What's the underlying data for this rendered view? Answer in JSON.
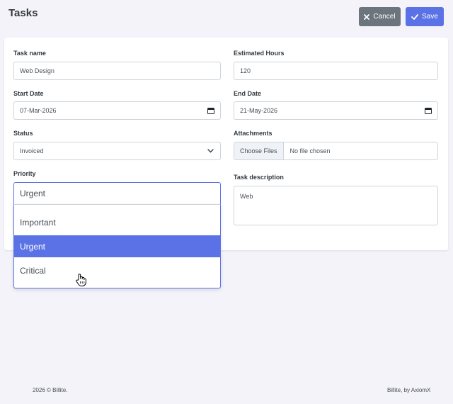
{
  "header": {
    "title": "Tasks",
    "cancel_label": "Cancel",
    "save_label": "Save"
  },
  "form": {
    "task_name": {
      "label": "Task name",
      "value": "Web Design"
    },
    "estimated_hours": {
      "label": "Estimated Hours",
      "value": "120"
    },
    "start_date": {
      "label": "Start Date",
      "value": "07-Mar-2026"
    },
    "end_date": {
      "label": "End Date",
      "value": "21-May-2026"
    },
    "status": {
      "label": "Status",
      "value": "Invoiced"
    },
    "attachments": {
      "label": "Attachments",
      "button": "Choose Files",
      "text": "No file chosen"
    },
    "priority": {
      "label": "Priority",
      "value": "Urgent",
      "options": [
        "Important",
        "Urgent",
        "Critical"
      ],
      "highlighted": "Urgent"
    },
    "task_description": {
      "label": "Task description",
      "value": "Web"
    }
  },
  "footer": {
    "left": "2026 © Billite.",
    "right": "Billite, by AxiomX"
  },
  "colors": {
    "primary": "#5a72e6",
    "secondary": "#6c757d",
    "background": "#f3f3f9"
  },
  "icons": {
    "cancel": "close-icon",
    "save": "check-icon",
    "date": "calendar-icon",
    "select": "chevron-down-icon",
    "cursor": "hand-pointer-icon"
  }
}
